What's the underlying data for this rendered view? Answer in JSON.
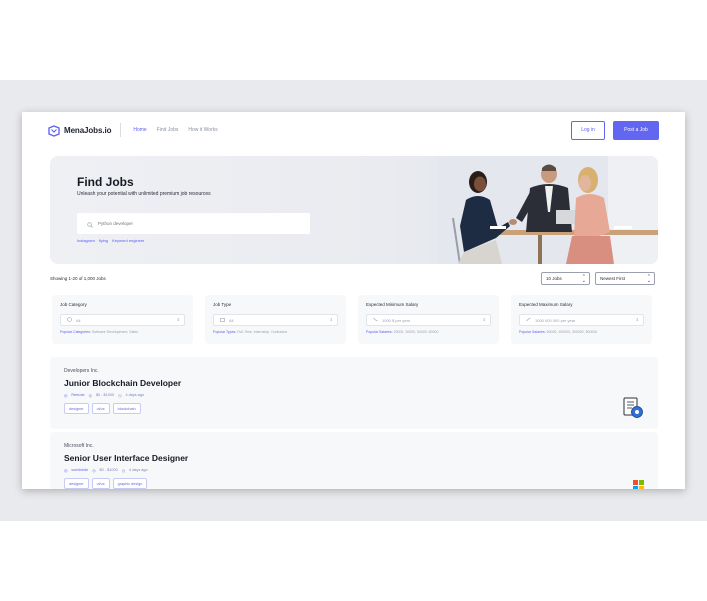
{
  "brand": {
    "name": "MenaJobs.io"
  },
  "nav": {
    "home": "Home",
    "find_jobs": "Find Jobs",
    "how_it_works": "How it Works"
  },
  "header_actions": {
    "login": "Log in",
    "post_job": "Post a Job"
  },
  "hero": {
    "title": "Find Jobs",
    "subtitle": "Unleash your potential with unlimited premium job resources",
    "search_placeholder": "Python developer",
    "tags": [
      "Instagram",
      "flying",
      "Keyword engineer"
    ]
  },
  "results": {
    "showing": "Showing 1-20 of 1,000 Jobs",
    "per_page": "10 Jobs",
    "sort": "Newest First"
  },
  "filters": [
    {
      "label": "Job Category",
      "value": "All",
      "popular_label": "Popular Categories:",
      "popular": "Software Development, Sales"
    },
    {
      "label": "Job Type",
      "value": "All",
      "popular_label": "Popular Types:",
      "popular": "Full-Time, Internship, Contractor"
    },
    {
      "label": "Expected Minimum Salary",
      "value": "1000 $ per year",
      "popular_label": "Popular Salaries:",
      "popular": "20000, 30000, 50000, 80000"
    },
    {
      "label": "Expected Maximum Salary",
      "value": "1000 000 000 per year",
      "popular_label": "Popular Salaries:",
      "popular": "60000, 100000, 300000, 500000"
    }
  ],
  "jobs": [
    {
      "company": "Developers Inc.",
      "title": "Junior Blockchain Developer",
      "location": "Remote",
      "salary": "$0 - $1000",
      "posted": "4 days ago",
      "skills": [
        "designer",
        "ui/ux",
        "blockchain"
      ],
      "logo_icon": "document-gear-icon"
    },
    {
      "company": "Microsoft Inc.",
      "title": "Senior User Interface Designer",
      "location": "worldwide",
      "salary": "$0 - $1000",
      "posted": "4 days ago",
      "skills": [
        "designer",
        "ui/ux",
        "graphic design"
      ],
      "logo_icon": "microsoft-logo-icon"
    }
  ],
  "colors": {
    "accent": "#6366f1",
    "hero_bg": "#eceef2",
    "card_bg": "#f7f8fa"
  }
}
